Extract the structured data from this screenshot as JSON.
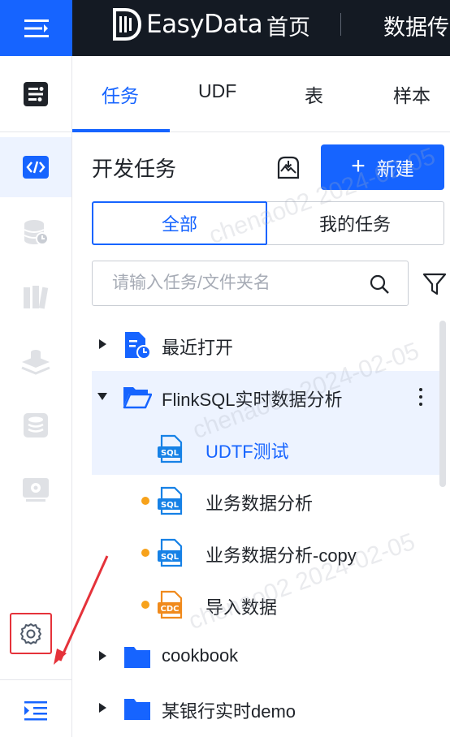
{
  "topbar": {
    "menu_icon": "menu-collapse-icon",
    "logo_icon": "easydata-logo-icon",
    "logo_text": "EasyData",
    "nav": [
      "首页",
      "数据传"
    ]
  },
  "rail": {
    "items": [
      {
        "icon": "pipeline-icon",
        "active": false
      },
      {
        "icon": "code-icon",
        "active": true
      },
      {
        "icon": "database-clock-icon",
        "active": false
      },
      {
        "icon": "library-icon",
        "active": false
      },
      {
        "icon": "stack-icon",
        "active": false
      },
      {
        "icon": "database-icon",
        "active": false
      },
      {
        "icon": "monitor-gear-icon",
        "active": false
      },
      {
        "icon": "gear-icon",
        "active": false
      },
      {
        "icon": "expand-indent-icon",
        "active": false
      }
    ]
  },
  "tabs": [
    {
      "label": "任务",
      "active": true
    },
    {
      "label": "UDF",
      "active": false
    },
    {
      "label": "表",
      "active": false
    },
    {
      "label": "样本",
      "active": false
    }
  ],
  "panel": {
    "title": "开发任务",
    "import_icon": "import-icon",
    "new_button": "新建"
  },
  "segments": {
    "all": "全部",
    "mine": "我的任务",
    "selected": "全部"
  },
  "search": {
    "placeholder": "请输入任务/文件夹名",
    "value": ""
  },
  "tree": [
    {
      "label": "最近打开",
      "icon": "recent-file-icon",
      "expanded": false,
      "level": 0
    },
    {
      "label": "FlinkSQL实时数据分析",
      "icon": "folder-open-icon",
      "expanded": true,
      "level": 0
    },
    {
      "label": "UDTF测试",
      "icon": "sql-file-icon",
      "level": 1,
      "selected": true,
      "modified": false
    },
    {
      "label": "业务数据分析",
      "icon": "sql-file-icon",
      "level": 1,
      "modified": true
    },
    {
      "label": "业务数据分析-copy",
      "icon": "sql-file-icon",
      "level": 1,
      "modified": true
    },
    {
      "label": "导入数据",
      "icon": "cdc-file-icon",
      "level": 1,
      "modified": true
    },
    {
      "label": "cookbook",
      "icon": "folder-icon",
      "expanded": false,
      "level": 0
    },
    {
      "label": "某银行实时demo",
      "icon": "folder-icon",
      "expanded": false,
      "level": 0
    }
  ],
  "watermarks": [
    "chenao02 2024-02-05",
    "chenao02 2024-02-05",
    "chenao02 2024-02-05"
  ],
  "colors": {
    "accent": "#1664ff",
    "topbar": "#141a23",
    "modified_dot": "#f7a21b",
    "highlight": "#e5323a"
  }
}
